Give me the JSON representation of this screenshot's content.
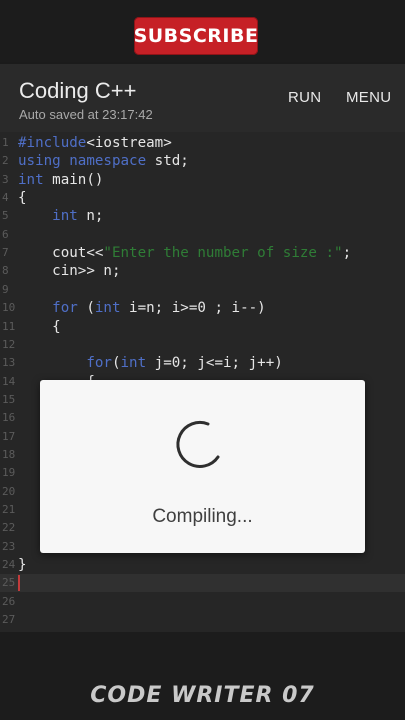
{
  "banner": {
    "subscribe_label": "SUBSCRIBE"
  },
  "header": {
    "title": "Coding C++",
    "autosave": "Auto saved at 23:17:42",
    "run_label": "RUN",
    "menu_label": "MENU"
  },
  "editor": {
    "lines": [
      {
        "n": "1",
        "parts": [
          {
            "t": "#include",
            "c": "kw"
          },
          {
            "t": "<iostream>",
            "c": ""
          }
        ]
      },
      {
        "n": "2",
        "parts": [
          {
            "t": "using namespace",
            "c": "kw"
          },
          {
            "t": " std;",
            "c": ""
          }
        ]
      },
      {
        "n": "3",
        "parts": [
          {
            "t": "int",
            "c": "kw"
          },
          {
            "t": " main()",
            "c": ""
          }
        ]
      },
      {
        "n": "4",
        "parts": [
          {
            "t": "{",
            "c": ""
          }
        ]
      },
      {
        "n": "5",
        "parts": [
          {
            "t": "    ",
            "c": ""
          },
          {
            "t": "int",
            "c": "kw"
          },
          {
            "t": " n;",
            "c": ""
          }
        ]
      },
      {
        "n": "6",
        "parts": []
      },
      {
        "n": "7",
        "parts": [
          {
            "t": "    cout<<",
            "c": ""
          },
          {
            "t": "\"Enter the number of size :\"",
            "c": "str"
          },
          {
            "t": ";",
            "c": ""
          }
        ]
      },
      {
        "n": "8",
        "parts": [
          {
            "t": "    cin>> n;",
            "c": ""
          }
        ]
      },
      {
        "n": "9",
        "parts": []
      },
      {
        "n": "10",
        "parts": [
          {
            "t": "    ",
            "c": ""
          },
          {
            "t": "for",
            "c": "kw"
          },
          {
            "t": " (",
            "c": ""
          },
          {
            "t": "int",
            "c": "kw"
          },
          {
            "t": " i=n; i>=0 ; i--)",
            "c": ""
          }
        ]
      },
      {
        "n": "11",
        "parts": [
          {
            "t": "    {",
            "c": ""
          }
        ]
      },
      {
        "n": "12",
        "parts": []
      },
      {
        "n": "13",
        "parts": [
          {
            "t": "        ",
            "c": ""
          },
          {
            "t": "for",
            "c": "kw"
          },
          {
            "t": "(",
            "c": ""
          },
          {
            "t": "int",
            "c": "kw"
          },
          {
            "t": " j=0; j<=i; j++)",
            "c": ""
          }
        ]
      },
      {
        "n": "14",
        "parts": [
          {
            "t": "        {",
            "c": ""
          }
        ]
      },
      {
        "n": "15",
        "parts": []
      },
      {
        "n": "16",
        "parts": []
      },
      {
        "n": "17",
        "parts": []
      },
      {
        "n": "18",
        "parts": []
      },
      {
        "n": "19",
        "parts": []
      },
      {
        "n": "20",
        "parts": []
      },
      {
        "n": "21",
        "parts": []
      },
      {
        "n": "22",
        "parts": []
      },
      {
        "n": "23",
        "parts": []
      },
      {
        "n": "24",
        "parts": [
          {
            "t": "}",
            "c": ""
          }
        ]
      },
      {
        "n": "25",
        "parts": []
      },
      {
        "n": "26",
        "parts": []
      },
      {
        "n": "27",
        "parts": []
      }
    ],
    "active_line": "25"
  },
  "dialog": {
    "message": "Compiling..."
  },
  "watermark": {
    "text": "CODE WRITER 07"
  },
  "colors": {
    "subscribe": "#c62026",
    "keyword": "#4f6fc7",
    "string": "#2f7d36"
  }
}
